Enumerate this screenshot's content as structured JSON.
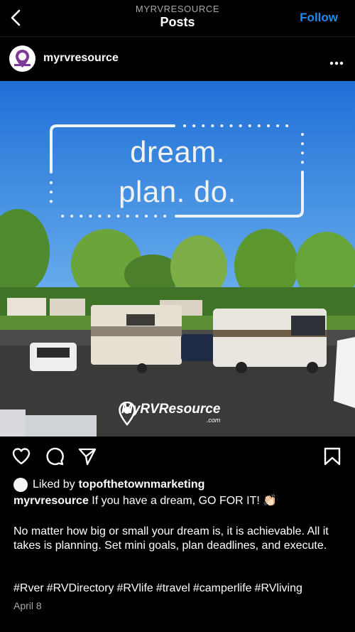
{
  "header": {
    "subtitle": "MYRVRESOURCE",
    "title": "Posts",
    "follow_label": "Follow"
  },
  "post": {
    "author": "myrvresource",
    "image": {
      "overlay_line1": "dream.",
      "overlay_line2": "plan. do.",
      "watermark_name": "MyRVResource",
      "watermark_domain": ".com"
    },
    "likes": {
      "prefix": "Liked by",
      "name": "topofthetownmarketing"
    },
    "caption_user": "myrvresource",
    "caption_text": "If you have a dream, GO FOR IT! 👏🏻",
    "body": "No matter how big or small your dream is, it is achievable. All it takes is planning. Set mini goals, plan deadlines, and execute.",
    "hashtags": [
      "#Rver",
      "#RVDirectory",
      "#RVlife",
      "#travel",
      "#camperlife",
      "#RVliving"
    ],
    "date": "April 8"
  },
  "colors": {
    "background": "#000000",
    "accent": "#1a8bf0",
    "muted": "#a8a8a8"
  },
  "icons": [
    "back-chevron-icon",
    "more-dots-icon",
    "heart-icon",
    "comment-icon",
    "share-icon",
    "bookmark-icon"
  ]
}
